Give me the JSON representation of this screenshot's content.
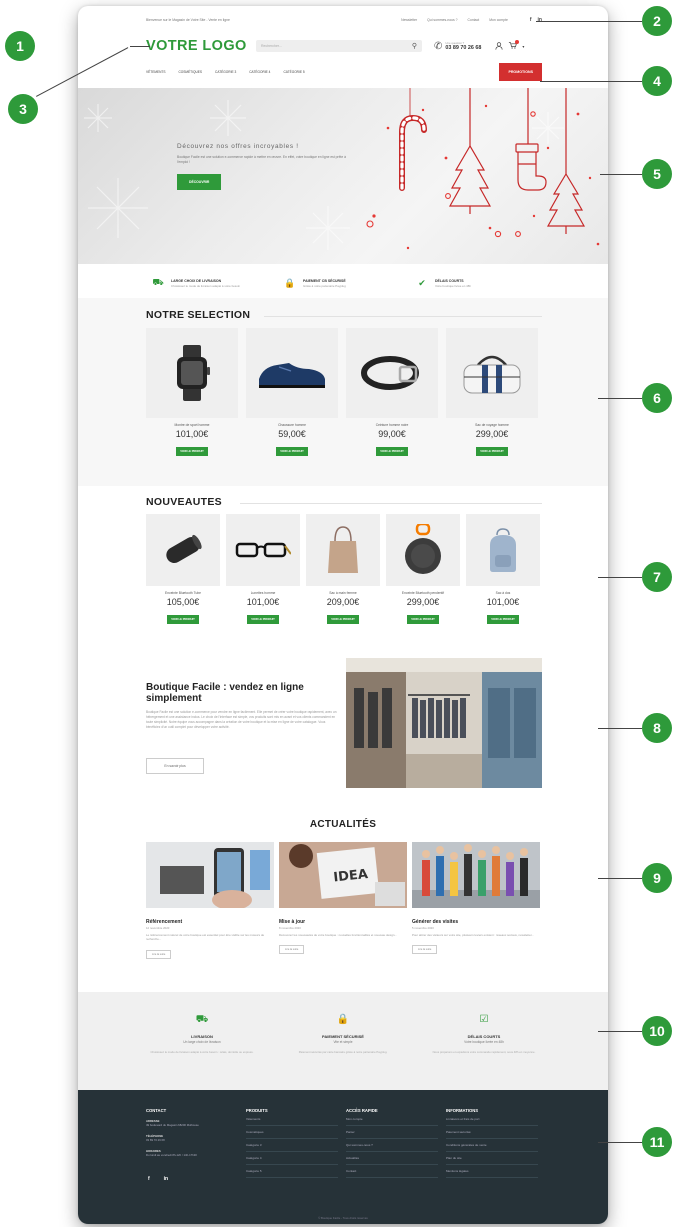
{
  "topbar": {
    "address": "Bienvenue sur le Magasin de Votre Site - Vente en ligne",
    "links": [
      "Newsletter",
      "Qui sommes-nous ?",
      "Contact",
      "Mon compte"
    ],
    "social": [
      "f",
      "in"
    ]
  },
  "header": {
    "logo": "VOTRE LOGO",
    "search_placeholder": "Rechercher...",
    "phone_label": "Une question ?",
    "phone": "03 89 70 26 68"
  },
  "nav": {
    "items": [
      "Vêtements",
      "Cosmétiques",
      "Catégorie 3",
      "Catégorie 4",
      "Catégorie 5"
    ],
    "promo": "Promotions"
  },
  "hero": {
    "title": "Découvrez nos offres incroyables !",
    "subtitle": "Boutique Facile est une solution e-commerce rapide à mettre en œuvre. En effet, votre boutique en ligne est prête à l'emploi !",
    "button": "Découvrir"
  },
  "features": [
    {
      "title": "Large choix de livraison",
      "sub": "Choisissez le mode de livraison adapté à votre besoin"
    },
    {
      "title": "Paiement CB sécurisé",
      "sub": "Grâce à notre partenaire Payplug"
    },
    {
      "title": "Délais courts",
      "sub": "Votre boutique livrée en 48h"
    }
  ],
  "selection": {
    "title": "NOTRE SELECTION",
    "button": "Voir le produit",
    "products": [
      {
        "name": "Montre de sport homme",
        "price": "101,00€"
      },
      {
        "name": "Chaussure homme",
        "price": "59,00€"
      },
      {
        "name": "Ceinture homme noire",
        "price": "99,00€"
      },
      {
        "name": "Sac de voyage homme",
        "price": "299,00€"
      }
    ]
  },
  "nouveautes": {
    "title": "NOUVEAUTES",
    "button": "Voir le produit",
    "products": [
      {
        "name": "Enceinte Bluetooth Tube",
        "price": "105,00€"
      },
      {
        "name": "Lunettes homme",
        "price": "101,00€"
      },
      {
        "name": "Sac à main femme",
        "price": "209,00€"
      },
      {
        "name": "Enceinte Bluetooth pendentif",
        "price": "299,00€"
      },
      {
        "name": "Sac à dos",
        "price": "101,00€"
      }
    ]
  },
  "about": {
    "title": "Boutique Facile : vendez en ligne simplement",
    "text": "Boutique Facile est une solution e-commerce pour vendre en ligne facilement. Elle permet de créer votre boutique rapidement, avec un hébergement et une assistance inclus. Le choix de l'interface est simple, vos produits sont mis en avant et vos clients commandent en toute simplicité. Notre équipe vous accompagne dans la création de votre boutique et la mise en ligne de votre catalogue. Vous bénéficiez d'un outil complet pour développer votre activité.",
    "button": "En savoir plus"
  },
  "news": {
    "title": "ACTUALITÉS",
    "button": "Lire la suite",
    "items": [
      {
        "title": "Référencement",
        "date": "12 novembre 2020",
        "text": "Le référencement naturel de votre boutique est essentiel pour être visible sur les moteurs de recherche..."
      },
      {
        "title": "Mise à jour",
        "date": "8 novembre 2020",
        "text": "Découvrez les nouveautés de votre boutique : nouvelles fonctionnalités et nouveau design..."
      },
      {
        "title": "Générer des visites",
        "date": "5 novembre 2020",
        "text": "Pour attirer des visiteurs sur votre site, plusieurs leviers existent : réseaux sociaux, newsletter..."
      }
    ]
  },
  "services": [
    {
      "title": "Livraison",
      "sub": "Un large choix de livraison",
      "desc": "Choisissez le mode de livraison adapté à votre besoin : relais, domicile ou express."
    },
    {
      "title": "Paiement sécurisé",
      "sub": "Vite et simple",
      "desc": "Paiement sécurisé par carte bancaire grâce à notre partenaire Payplug."
    },
    {
      "title": "Délais courts",
      "sub": "Votre boutique livrée en 48h",
      "desc": "Nous préparons et expédions votre commande rapidement, sous 48h en moyenne."
    }
  ],
  "footer": {
    "contact": {
      "title": "Contact",
      "address_label": "Adresse",
      "address": "49 boulevard du Magasin 68200 Mulhouse",
      "phone_label": "Téléphone",
      "phone": "03 89 70 26 68",
      "hours_label": "Horaires",
      "hours": "Du lundi au vendredi 8h-12h / 14h-17h30"
    },
    "produits": {
      "title": "Produits",
      "items": [
        "Vêtements",
        "Cosmétiques",
        "Catégorie 3",
        "Catégorie 4",
        "Catégorie 5"
      ]
    },
    "acces": {
      "title": "Accès rapide",
      "items": [
        "Mon compte",
        "Panier",
        "Qui sommes-nous ?",
        "Actualités",
        "Contact"
      ]
    },
    "infos": {
      "title": "Informations",
      "items": [
        "Livraisons et frais de port",
        "Paiement sécurisé",
        "Conditions générales de vente",
        "Plan du site",
        "Mentions légales"
      ]
    },
    "social": [
      "f",
      "in"
    ],
    "copyright": "© Boutique Facile - Tous droits réservés"
  },
  "callouts": [
    "1",
    "2",
    "3",
    "4",
    "5",
    "6",
    "7",
    "8",
    "9",
    "10",
    "11"
  ],
  "colors": {
    "accent": "#2f9a3a",
    "promo": "#d32f2f",
    "footer": "#263238",
    "callout": "#2e9a3a"
  }
}
